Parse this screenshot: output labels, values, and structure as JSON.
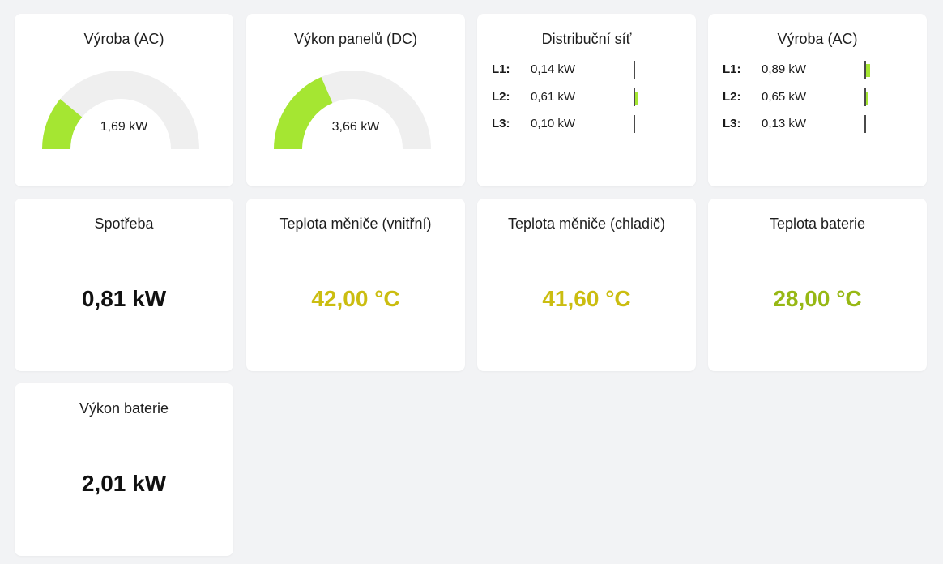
{
  "colors": {
    "gauge_fill": "#a5e632",
    "gauge_track": "#efefef",
    "temp_yellow": "#cbbd10",
    "temp_green": "#97b814"
  },
  "cards": {
    "vyroba_gauge": {
      "title": "Výroba (AC)",
      "value": "1,69 kW",
      "fraction": 0.22
    },
    "panely_gauge": {
      "title": "Výkon panelů (DC)",
      "value": "3,66 kW",
      "fraction": 0.37
    },
    "distribucni_sit": {
      "title": "Distribuční síť",
      "phases": [
        {
          "label": "L1:",
          "value": "0,14 kW",
          "fraction": 0.02
        },
        {
          "label": "L2:",
          "value": "0,61 kW",
          "fraction": 0.08
        },
        {
          "label": "L3:",
          "value": "0,10 kW",
          "fraction": 0.01
        }
      ]
    },
    "vyroba_phases": {
      "title": "Výroba (AC)",
      "phases": [
        {
          "label": "L1:",
          "value": "0,89 kW",
          "fraction": 0.12
        },
        {
          "label": "L2:",
          "value": "0,65 kW",
          "fraction": 0.09
        },
        {
          "label": "L3:",
          "value": "0,13 kW",
          "fraction": 0.01
        }
      ]
    },
    "spotreba": {
      "title": "Spotřeba",
      "value": "0,81 kW"
    },
    "teplota_vnitrni": {
      "title": "Teplota měniče (vnitřní)",
      "value": "42,00 °C"
    },
    "teplota_chladic": {
      "title": "Teplota měniče (chladič)",
      "value": "41,60 °C"
    },
    "teplota_baterie": {
      "title": "Teplota baterie",
      "value": "28,00 °C"
    },
    "vykon_baterie": {
      "title": "Výkon baterie",
      "value": "2,01 kW"
    }
  }
}
